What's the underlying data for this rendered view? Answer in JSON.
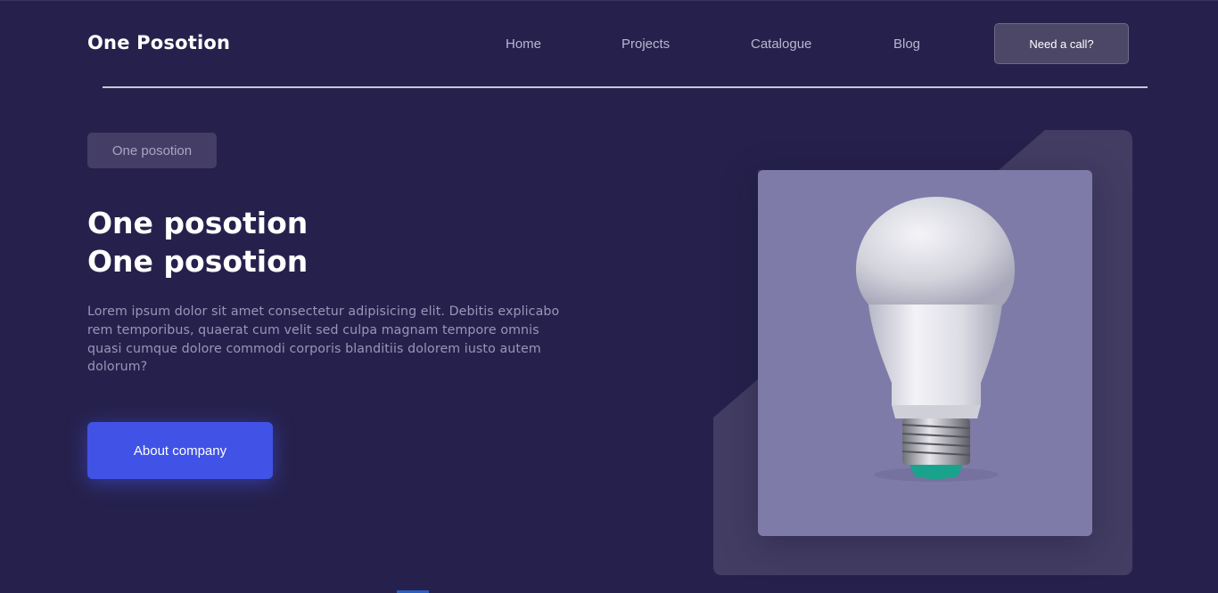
{
  "header": {
    "logo": "One Posotion",
    "nav": [
      "Home",
      "Projects",
      "Catalogue",
      "Blog"
    ],
    "cta": "Need a call?"
  },
  "hero": {
    "badge": "One posotion",
    "title_line1": "One posotion",
    "title_line2": "One posotion",
    "description": "Lorem ipsum dolor sit amet consectetur adipisicing elit. Debitis explicabo rem temporibus, quaerat cum velit sed culpa magnam tempore omnis quasi cumque dolore commodi corporis blanditiis dolorem iusto autem dolorum?",
    "button": "About company"
  },
  "media": {
    "image": "light-bulb-icon"
  },
  "colors": {
    "background": "#26214c",
    "accent": "#4152e6",
    "card": "#7f7ba9",
    "panel": "#443e66"
  }
}
